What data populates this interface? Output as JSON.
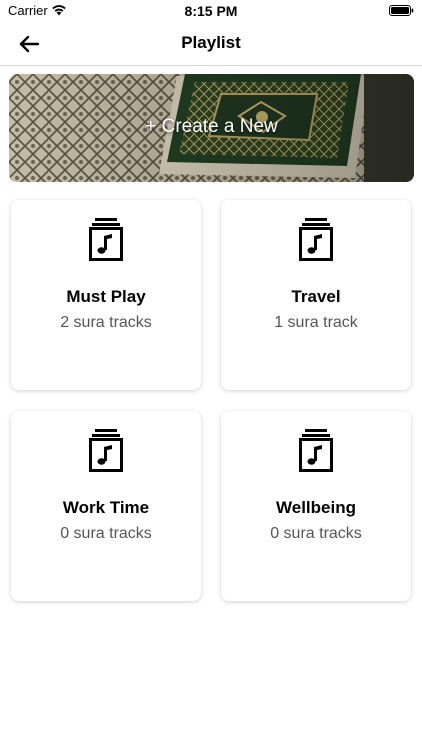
{
  "status_bar": {
    "carrier": "Carrier",
    "time": "8:15 PM"
  },
  "nav": {
    "title": "Playlist",
    "back_icon": "arrow-left-icon"
  },
  "banner": {
    "label": "+ Create a New"
  },
  "playlists": [
    {
      "title": "Must Play",
      "subtitle": "2 sura tracks",
      "icon": "music-file-icon"
    },
    {
      "title": "Travel",
      "subtitle": "1 sura track",
      "icon": "music-file-icon"
    },
    {
      "title": "Work Time",
      "subtitle": "0 sura tracks",
      "icon": "music-file-icon"
    },
    {
      "title": "Wellbeing",
      "subtitle": "0 sura tracks",
      "icon": "music-file-icon"
    }
  ]
}
